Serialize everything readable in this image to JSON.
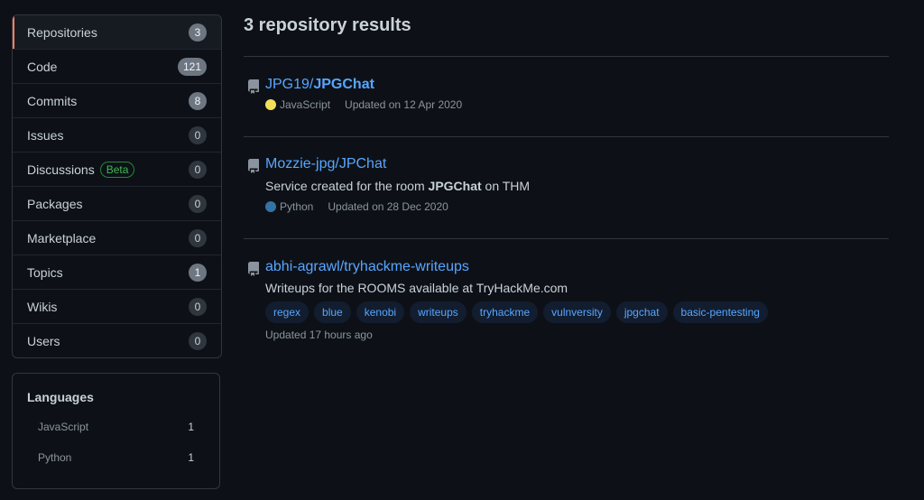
{
  "sidebar": {
    "items": [
      {
        "label": "Repositories",
        "count": "3",
        "selected": true
      },
      {
        "label": "Code",
        "count": "121"
      },
      {
        "label": "Commits",
        "count": "8"
      },
      {
        "label": "Issues",
        "count": "0"
      },
      {
        "label": "Discussions",
        "badge": "Beta",
        "count": "0"
      },
      {
        "label": "Packages",
        "count": "0"
      },
      {
        "label": "Marketplace",
        "count": "0"
      },
      {
        "label": "Topics",
        "count": "1"
      },
      {
        "label": "Wikis",
        "count": "0"
      },
      {
        "label": "Users",
        "count": "0"
      }
    ]
  },
  "languages": {
    "title": "Languages",
    "items": [
      {
        "name": "JavaScript",
        "count": "1"
      },
      {
        "name": "Python",
        "count": "1"
      }
    ]
  },
  "main": {
    "results_title": "3 repository results",
    "results": [
      {
        "owner": "JPG19/",
        "name": "JPGChat",
        "language": "JavaScript",
        "language_color": "#f1e05a",
        "updated": "Updated on 12 Apr 2020"
      },
      {
        "owner": "Mozzie-jpg/",
        "name": "JPChat",
        "description_before": "Service created for the room ",
        "description_bold": "JPGChat",
        "description_after": " on THM",
        "language": "Python",
        "language_color": "#3572A5",
        "updated": "Updated on 28 Dec 2020"
      },
      {
        "owner": "abhi-agrawl/",
        "name": "tryhackme-writeups",
        "description": "Writeups for the ROOMS available at TryHackMe.com",
        "topics": [
          "regex",
          "blue",
          "kenobi",
          "writeups",
          "tryhackme",
          "vulnversity",
          "jpgchat",
          "basic-pentesting"
        ],
        "updated": "Updated 17 hours ago"
      }
    ]
  },
  "colors": {
    "background": "#0d1117",
    "link": "#58a6ff",
    "selected_indicator": "#f78166",
    "beta_green": "#3fb950"
  }
}
